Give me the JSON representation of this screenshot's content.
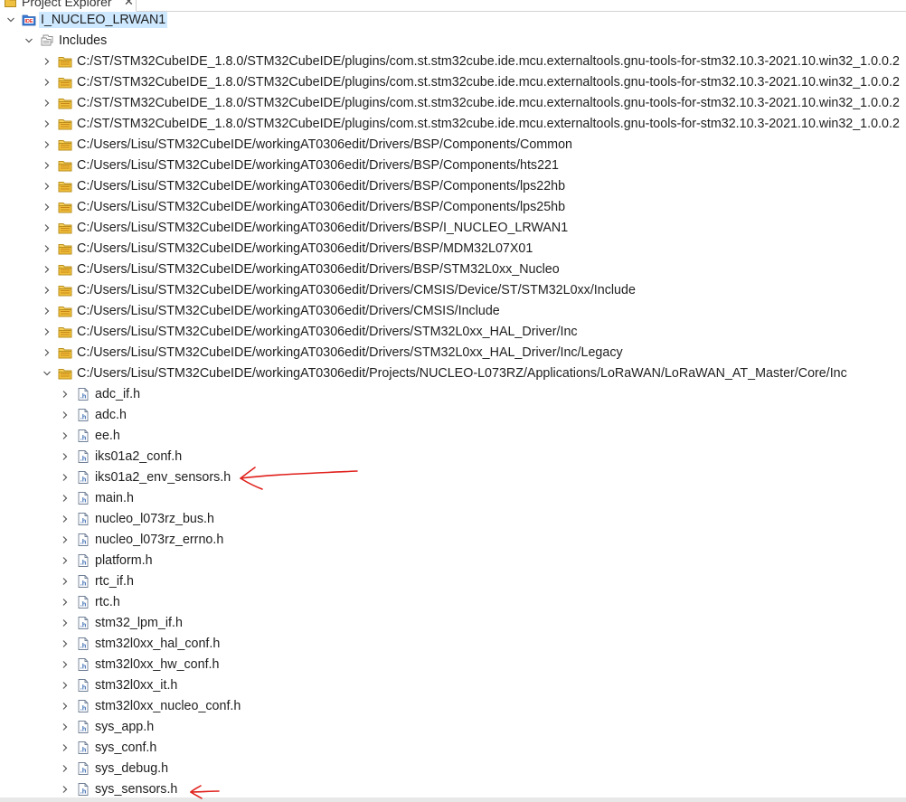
{
  "panel": {
    "title": "Project Explorer",
    "close_glyph": "✕"
  },
  "tree": {
    "project": {
      "label": "I_NUCLEO_LRWAN1",
      "icon": "ide-project-icon",
      "expanded": true
    },
    "includes": {
      "label": "Includes",
      "icon": "includes-folder-icon",
      "expanded": true
    },
    "include_paths": [
      {
        "label": "C:/ST/STM32CubeIDE_1.8.0/STM32CubeIDE/plugins/com.st.stm32cube.ide.mcu.externaltools.gnu-tools-for-stm32.10.3-2021.10.win32_1.0.0.2",
        "expanded": false
      },
      {
        "label": "C:/ST/STM32CubeIDE_1.8.0/STM32CubeIDE/plugins/com.st.stm32cube.ide.mcu.externaltools.gnu-tools-for-stm32.10.3-2021.10.win32_1.0.0.2",
        "expanded": false
      },
      {
        "label": "C:/ST/STM32CubeIDE_1.8.0/STM32CubeIDE/plugins/com.st.stm32cube.ide.mcu.externaltools.gnu-tools-for-stm32.10.3-2021.10.win32_1.0.0.2",
        "expanded": false
      },
      {
        "label": "C:/ST/STM32CubeIDE_1.8.0/STM32CubeIDE/plugins/com.st.stm32cube.ide.mcu.externaltools.gnu-tools-for-stm32.10.3-2021.10.win32_1.0.0.2",
        "expanded": false
      },
      {
        "label": "C:/Users/Lisu/STM32CubeIDE/workingAT0306edit/Drivers/BSP/Components/Common",
        "expanded": false
      },
      {
        "label": "C:/Users/Lisu/STM32CubeIDE/workingAT0306edit/Drivers/BSP/Components/hts221",
        "expanded": false
      },
      {
        "label": "C:/Users/Lisu/STM32CubeIDE/workingAT0306edit/Drivers/BSP/Components/lps22hb",
        "expanded": false
      },
      {
        "label": "C:/Users/Lisu/STM32CubeIDE/workingAT0306edit/Drivers/BSP/Components/lps25hb",
        "expanded": false
      },
      {
        "label": "C:/Users/Lisu/STM32CubeIDE/workingAT0306edit/Drivers/BSP/I_NUCLEO_LRWAN1",
        "expanded": false
      },
      {
        "label": "C:/Users/Lisu/STM32CubeIDE/workingAT0306edit/Drivers/BSP/MDM32L07X01",
        "expanded": false
      },
      {
        "label": "C:/Users/Lisu/STM32CubeIDE/workingAT0306edit/Drivers/BSP/STM32L0xx_Nucleo",
        "expanded": false
      },
      {
        "label": "C:/Users/Lisu/STM32CubeIDE/workingAT0306edit/Drivers/CMSIS/Device/ST/STM32L0xx/Include",
        "expanded": false
      },
      {
        "label": "C:/Users/Lisu/STM32CubeIDE/workingAT0306edit/Drivers/CMSIS/Include",
        "expanded": false
      },
      {
        "label": "C:/Users/Lisu/STM32CubeIDE/workingAT0306edit/Drivers/STM32L0xx_HAL_Driver/Inc",
        "expanded": false
      },
      {
        "label": "C:/Users/Lisu/STM32CubeIDE/workingAT0306edit/Drivers/STM32L0xx_HAL_Driver/Inc/Legacy",
        "expanded": false
      },
      {
        "label": "C:/Users/Lisu/STM32CubeIDE/workingAT0306edit/Projects/NUCLEO-L073RZ/Applications/LoRaWAN/LoRaWAN_AT_Master/Core/Inc",
        "expanded": true
      }
    ],
    "header_files": [
      "adc_if.h",
      "adc.h",
      "ee.h",
      "iks01a2_conf.h",
      "iks01a2_env_sensors.h",
      "main.h",
      "nucleo_l073rz_bus.h",
      "nucleo_l073rz_errno.h",
      "platform.h",
      "rtc_if.h",
      "rtc.h",
      "stm32_lpm_if.h",
      "stm32l0xx_hal_conf.h",
      "stm32l0xx_hw_conf.h",
      "stm32l0xx_it.h",
      "stm32l0xx_nucleo_conf.h",
      "sys_app.h",
      "sys_conf.h",
      "sys_debug.h",
      "sys_sensors.h"
    ]
  },
  "annotations": {
    "arrow_color": "#e0201b",
    "marked_files": [
      "iks01a2_env_sensors.h",
      "sys_sensors.h"
    ]
  },
  "colors": {
    "selection": "#cde8ff",
    "folder": "#f0c040",
    "header_file": "#4f7fc0"
  }
}
